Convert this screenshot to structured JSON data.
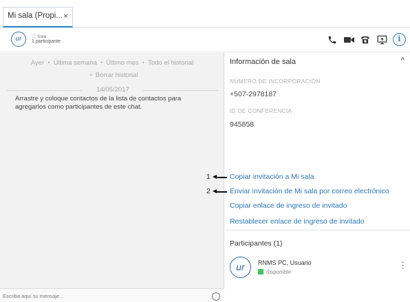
{
  "tab": {
    "label": "Mi sala (Propi...",
    "close": "×"
  },
  "header": {
    "avatar": "ur",
    "room_kind": "ⓘ Sala",
    "participants_count": "1 participante",
    "icons": [
      "phone-icon",
      "video-camera-icon",
      "desk-phone-icon",
      "screen-share-icon",
      "info-icon"
    ],
    "info_glyph": "i"
  },
  "chat": {
    "filters": [
      "Ayer",
      "Última semana",
      "Último mes",
      "Todo el historial",
      "Borrar historial"
    ],
    "separator": "•",
    "date": "14/05/2017",
    "drop_message": "Arrastre y coloque contactos de la lista de contactos para agregarlos como participantes de este chat.",
    "composer_placeholder": "Escriba aquí su mensaje..."
  },
  "info": {
    "title": "Información de sala",
    "collapse_glyph": "^",
    "dial_in_label": "NÚMERO DE INCORPORACIÓN",
    "dial_in_value": "+507-2978187",
    "conference_label": "ID DE CONFERENCIA",
    "conference_value": "945858",
    "links": {
      "copy_invite": "Copiar invitación a Mi sala",
      "email_invite": "Enviar invitación de Mi sala por correo electrónico",
      "copy_guest_link": "Copiar enlace de ingreso de invitado",
      "reset_guest_link": "Restablecer enlace de ingreso de invitado"
    },
    "participants_title": "Participantes (1)",
    "participant": {
      "avatar": "ur",
      "name": "RNMS PC, Usuario",
      "status": "disponible"
    },
    "more_glyph": "⋮"
  },
  "annotations": {
    "one": "1",
    "two": "2"
  },
  "colors": {
    "accent": "#2b7fc4",
    "link": "#2b78b8",
    "available": "#3ec45a",
    "chat_bg": "#f2f2f2"
  }
}
